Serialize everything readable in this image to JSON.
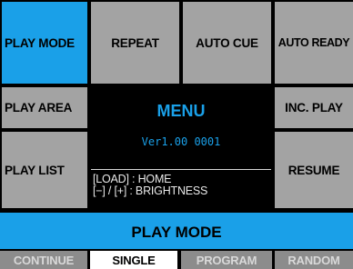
{
  "buttons": {
    "play_mode": "PLAY MODE",
    "repeat": "REPEAT",
    "auto_cue": "AUTO CUE",
    "auto_ready": "AUTO READY",
    "play_area": "PLAY AREA",
    "inc_play": "INC. PLAY",
    "play_list": "PLAY LIST",
    "resume": "RESUME"
  },
  "menu": {
    "title": "MENU",
    "version": "Ver1.00 0001",
    "hint_load": "[LOAD] : HOME",
    "hint_brightness": "[−] / [+] : BRIGHTNESS"
  },
  "mode_bar": {
    "title": "PLAY MODE",
    "options": [
      "CONTINUE",
      "SINGLE",
      "PROGRAM",
      "RANDOM"
    ],
    "selected": "SINGLE"
  },
  "colors": {
    "accent": "#1aa0e8",
    "button_bg": "#a3a3a3",
    "option_bg": "#8c8c8c",
    "selected_bg": "#ffffff"
  }
}
